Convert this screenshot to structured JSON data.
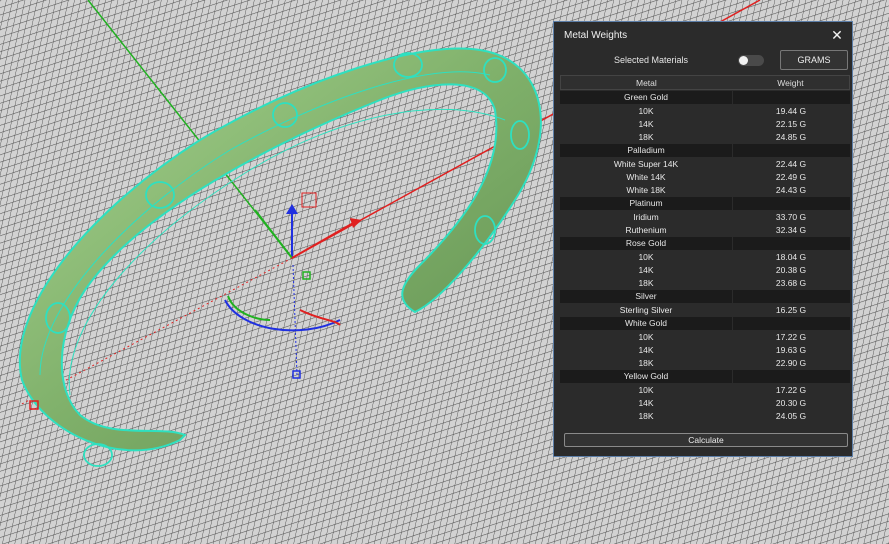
{
  "colors": {
    "grid_bg": "#cfcfcf",
    "grid_line": "#5a5a5a",
    "bracelet_fill": "#8fbf7a",
    "bracelet_edge": "#2ee0c0",
    "axis_x": "#e02020",
    "axis_y": "#20b020",
    "axis_z": "#2030e0",
    "panel_bg": "#2b2b2b",
    "panel_border": "#5c7ea8"
  },
  "panel": {
    "title": "Metal Weights",
    "close_icon": "close-icon",
    "selected_materials_label": "Selected Materials",
    "selected_materials_enabled": false,
    "units_button": "GRAMS",
    "columns": [
      "Metal",
      "Weight"
    ],
    "groups": [
      {
        "name": "Green Gold",
        "rows": [
          {
            "metal": "10K",
            "weight": "19.44 G"
          },
          {
            "metal": "14K",
            "weight": "22.15 G"
          },
          {
            "metal": "18K",
            "weight": "24.85 G"
          }
        ]
      },
      {
        "name": "Palladium",
        "rows": [
          {
            "metal": "White Super 14K",
            "weight": "22.44 G"
          },
          {
            "metal": "White 14K",
            "weight": "22.49 G"
          },
          {
            "metal": "White 18K",
            "weight": "24.43 G"
          }
        ]
      },
      {
        "name": "Platinum",
        "rows": [
          {
            "metal": "Iridium",
            "weight": "33.70 G"
          },
          {
            "metal": "Ruthenium",
            "weight": "32.34 G"
          }
        ]
      },
      {
        "name": "Rose Gold",
        "rows": [
          {
            "metal": "10K",
            "weight": "18.04 G"
          },
          {
            "metal": "14K",
            "weight": "20.38 G"
          },
          {
            "metal": "18K",
            "weight": "23.68 G"
          }
        ]
      },
      {
        "name": "Silver",
        "rows": [
          {
            "metal": "Sterling Silver",
            "weight": "16.25 G"
          }
        ]
      },
      {
        "name": "White Gold",
        "rows": [
          {
            "metal": "10K",
            "weight": "17.22 G"
          },
          {
            "metal": "14K",
            "weight": "19.63 G"
          },
          {
            "metal": "18K",
            "weight": "22.90 G"
          }
        ]
      },
      {
        "name": "Yellow Gold",
        "rows": [
          {
            "metal": "10K",
            "weight": "17.22 G"
          },
          {
            "metal": "14K",
            "weight": "20.30 G"
          },
          {
            "metal": "18K",
            "weight": "24.05 G"
          }
        ]
      }
    ],
    "calculate_button": "Calculate"
  }
}
